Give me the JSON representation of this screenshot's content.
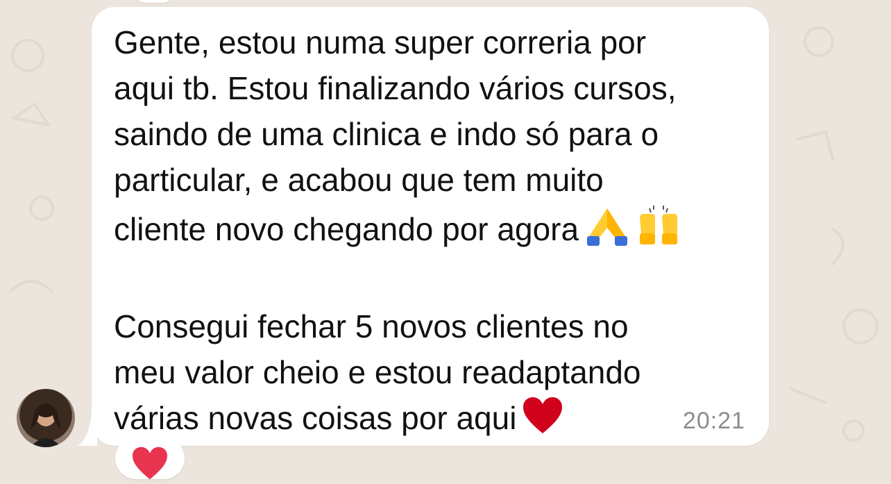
{
  "message": {
    "lines": [
      "Gente, estou numa super correria por",
      "aqui tb. Estou finalizando vários cursos,",
      "saindo de uma clinica e indo só para o",
      "particular, e acabou que tem muito",
      "cliente novo chegando por agora",
      "",
      "Consegui fechar 5 novos clientes no",
      "meu valor cheio e estou readaptando",
      "várias novas coisas por aqui"
    ],
    "emojis_line5": [
      "folded-hands",
      "raising-hands"
    ],
    "emoji_line9": "red-heart",
    "time": "20:21"
  },
  "reaction": {
    "emoji": "red-heart"
  },
  "colors": {
    "background": "#ece5dd",
    "bubble": "#ffffff",
    "text": "#111111",
    "timestamp": "#8c8c8c",
    "heart": "#d0021b",
    "hands_skin": "#ffcc33",
    "sleeve": "#3b6fd8"
  }
}
